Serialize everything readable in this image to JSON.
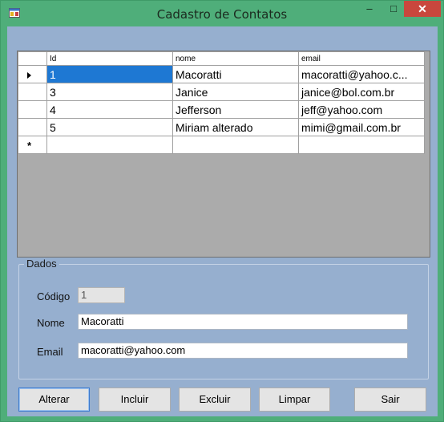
{
  "window": {
    "title": "Cadastro de Contatos",
    "minimize_glyph": "–",
    "maximize_glyph": "□",
    "close_glyph": "✕",
    "close_color": "#c9473d",
    "frame_color": "#4fae7a"
  },
  "grid": {
    "columns": [
      "Id",
      "nome",
      "email"
    ],
    "rows": [
      {
        "id": "1",
        "nome": "Macoratti",
        "email": "macoratti@yahoo.c...",
        "current": true
      },
      {
        "id": "3",
        "nome": "Janice",
        "email": "janice@bol.com.br",
        "current": false
      },
      {
        "id": "4",
        "nome": "Jefferson",
        "email": "jeff@yahoo.com",
        "current": false
      },
      {
        "id": "5",
        "nome": "Miriam alterado",
        "email": "mimi@gmail.com.br",
        "current": false
      }
    ],
    "new_row_glyph": "*",
    "selection_color": "#1e78d3"
  },
  "dados": {
    "group_title": "Dados",
    "codigo_label": "Código",
    "codigo_value": "1",
    "nome_label": "Nome",
    "nome_value": "Macoratti",
    "email_label": "Email",
    "email_value": "macoratti@yahoo.com"
  },
  "buttons": {
    "alterar": "Alterar",
    "incluir": "Incluir",
    "excluir": "Excluir",
    "limpar": "Limpar",
    "sair": "Sair"
  }
}
